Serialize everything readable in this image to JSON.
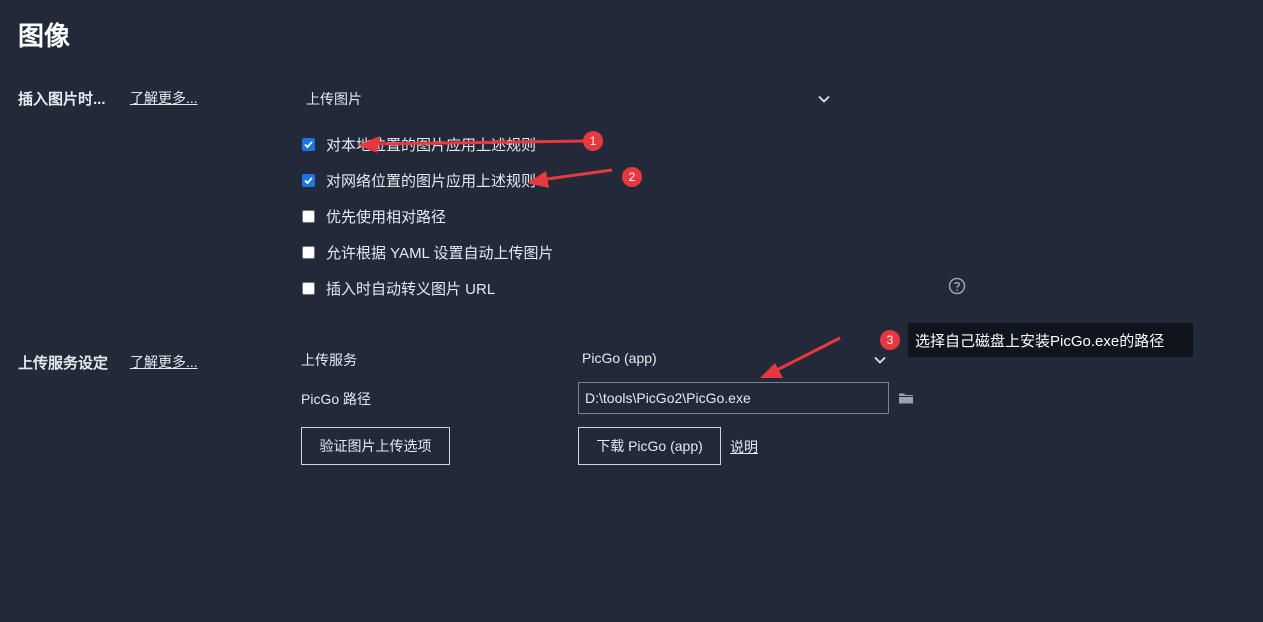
{
  "page_title": "图像",
  "insert": {
    "label": "插入图片时...",
    "learn_more": "了解更多...",
    "select_value": "上传图片",
    "checkboxes": [
      {
        "label": "对本地位置的图片应用上述规则",
        "checked": true
      },
      {
        "label": "对网络位置的图片应用上述规则",
        "checked": true
      },
      {
        "label": "优先使用相对路径",
        "checked": false
      },
      {
        "label": "允许根据 YAML 设置自动上传图片",
        "checked": false
      },
      {
        "label": "插入时自动转义图片 URL",
        "checked": false
      }
    ],
    "help_icon": "question-circle-icon"
  },
  "upload": {
    "label": "上传服务设定",
    "learn_more": "了解更多...",
    "service_label": "上传服务",
    "service_value": "PicGo (app)",
    "path_label": "PicGo 路径",
    "path_value": "D:\\tools\\PicGo2\\PicGo.exe",
    "folder_icon": "folder-icon",
    "verify_button": "验证图片上传选项",
    "download_button": "下载 PicGo (app)",
    "explain_link": "说明"
  },
  "annotations": {
    "badges": [
      "1",
      "2",
      "3"
    ],
    "tooltip": "选择自己磁盘上安装PicGo.exe的路径",
    "arrow_color": "#e8383d"
  },
  "colors": {
    "background": "#222a3a",
    "checkbox_checked": "#1a73e8",
    "badge": "#e8383d",
    "tooltip_bg": "#10141c"
  }
}
